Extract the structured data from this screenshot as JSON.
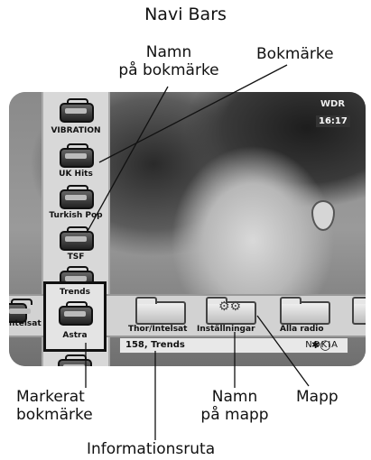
{
  "title": "Navi Bars",
  "labels": {
    "bookmark_name": "Namn\npå bokmärke",
    "bookmark": "Bokmärke",
    "marked_bookmark": "Markerat\nbokmärke",
    "folder_name": "Namn\npå mapp",
    "folder": "Mapp",
    "info_box": "Informationsruta"
  },
  "screen": {
    "channel_logo": "WDR",
    "clock": "16:17",
    "vertical_bar_items": [
      "VIBRATION",
      "UK Hits",
      "Turkish Pop",
      "TSF",
      "Trends"
    ],
    "highlighted_item_label": "Astra",
    "horizontal_bar_items": [
      "ntelsat",
      "Thor/Intelsat",
      "Inställningar",
      "Alla radio"
    ],
    "info_box": {
      "text": "158, Trends",
      "brand": "NOKIA"
    }
  }
}
